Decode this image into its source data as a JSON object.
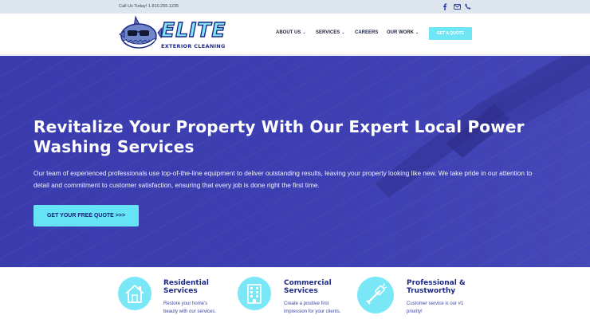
{
  "topbar": {
    "call_text": "Call Us Today! 1.810.255.1235",
    "social": [
      {
        "icon": "facebook-icon"
      },
      {
        "icon": "mail-icon"
      },
      {
        "icon": "phone-icon"
      }
    ]
  },
  "header": {
    "logo": {
      "word": "ELITE",
      "sub": "EXTERIOR CLEANING"
    },
    "nav": [
      {
        "label": "ABOUT US",
        "has_dropdown": true
      },
      {
        "label": "SERVICES",
        "has_dropdown": true
      },
      {
        "label": "CAREERS",
        "has_dropdown": false
      },
      {
        "label": "OUR WORK",
        "has_dropdown": true
      }
    ],
    "quote_button": "GET A QUOTE"
  },
  "hero": {
    "title": "Revitalize Your Property With Our Expert Local Power Washing Services",
    "body": "Our team of experienced professionals use top-of-the-line equipment to deliver outstanding results, leaving your property looking like new. We take pride in our attention to detail and commitment to customer satisfaction, ensuring that every job is done right the first time.",
    "cta": "GET YOUR FREE QUOTE >>>"
  },
  "features": [
    {
      "icon": "house-icon",
      "title_line1": "Residential",
      "title_line2": "Services",
      "desc_line1": "Restore your home's",
      "desc_line2": "beauty with our services."
    },
    {
      "icon": "building-icon",
      "title_line1": "Commercial",
      "title_line2": "Services",
      "desc_line1": "Create a positive first",
      "desc_line2": "impression for your clients."
    },
    {
      "icon": "spray-wand-icon",
      "title_line1": "Professional &",
      "title_line2": "Trustworthy",
      "desc_line1": "Customer service is our #1",
      "desc_line2": "priority!"
    }
  ],
  "colors": {
    "topbar_bg": "#dde5ee",
    "hero_bg": "#3d3fb2",
    "accent_cyan": "#6ee6f6",
    "brand_navy": "#1d2a86"
  }
}
